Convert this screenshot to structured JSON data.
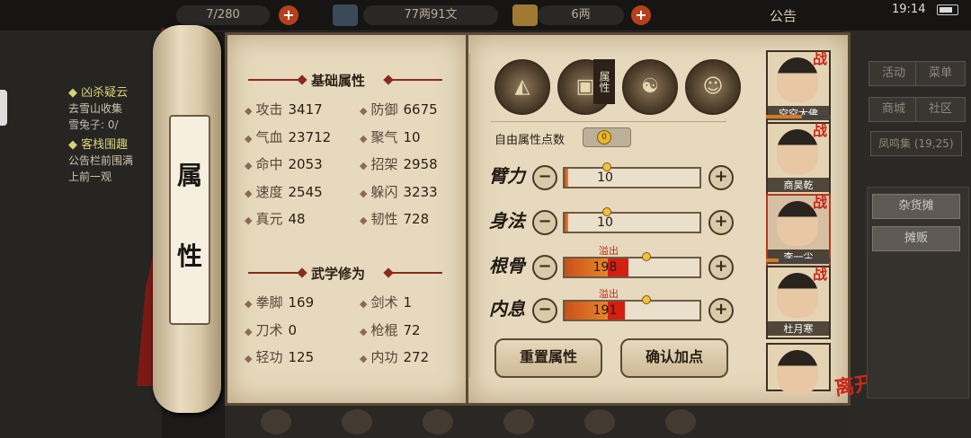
{
  "topbar": {
    "bag_count": "7/280",
    "money": "77两91文",
    "gold": "6两",
    "notice": "公告",
    "time": "19:14"
  },
  "quests": [
    {
      "kind": "title",
      "text": "◆ 凶杀疑云"
    },
    {
      "kind": "text",
      "text": "去雪山收集"
    },
    {
      "kind": "dim",
      "text": "雪兔子: 0/"
    },
    {
      "kind": "title",
      "text": "◆ 客栈围趣"
    },
    {
      "kind": "text",
      "text": "公告栏前围满"
    },
    {
      "kind": "text",
      "text": "上前一观"
    }
  ],
  "scroll_label": [
    "属",
    "性"
  ],
  "basic": {
    "title": "基础属性",
    "stats": [
      {
        "label": "攻击",
        "value": "3417"
      },
      {
        "label": "防御",
        "value": "6675"
      },
      {
        "label": "气血",
        "value": "23712"
      },
      {
        "label": "聚气",
        "value": "10"
      },
      {
        "label": "命中",
        "value": "2053"
      },
      {
        "label": "招架",
        "value": "2958"
      },
      {
        "label": "速度",
        "value": "2545"
      },
      {
        "label": "躲闪",
        "value": "3233"
      },
      {
        "label": "真元",
        "value": "48"
      },
      {
        "label": "韧性",
        "value": "728"
      }
    ]
  },
  "martial": {
    "title": "武学修为",
    "stats": [
      {
        "label": "拳脚",
        "value": "169"
      },
      {
        "label": "剑术",
        "value": "1"
      },
      {
        "label": "刀术",
        "value": "0"
      },
      {
        "label": "枪棍",
        "value": "72"
      },
      {
        "label": "轻功",
        "value": "125"
      },
      {
        "label": "内功",
        "value": "272"
      }
    ]
  },
  "equipment": {
    "tab_label": "属性",
    "icons": [
      "hat-icon",
      "armor-icon",
      "yinyang-icon",
      "figure-icon"
    ]
  },
  "points": {
    "free_label": "自由属性点数",
    "free_value": "0",
    "overflow_label": "溢出",
    "rows": [
      {
        "label": "臂力",
        "value": "10",
        "fill": 0.03,
        "over": 0,
        "overflow": false
      },
      {
        "label": "身法",
        "value": "10",
        "fill": 0.03,
        "over": 0,
        "overflow": false
      },
      {
        "label": "根骨",
        "value": "198",
        "fill": 0.33,
        "over": 0.16,
        "overflow": true
      },
      {
        "label": "内息",
        "value": "191",
        "fill": 0.33,
        "over": 0.13,
        "overflow": true
      }
    ],
    "minus": "−",
    "plus": "+"
  },
  "buttons": {
    "reset": "重置属性",
    "confirm": "确认加点"
  },
  "heroes": [
    {
      "name": "空空大佛",
      "badge": "战",
      "hp": 0.55
    },
    {
      "name": "商昊乾",
      "badge": "战",
      "hp": 0
    },
    {
      "name": "李一尘",
      "badge": "战",
      "hp": 0.2
    },
    {
      "name": "杜月寒",
      "badge": "战",
      "hp": 0
    },
    {
      "name": "",
      "badge": "",
      "hp": 0
    }
  ],
  "leave_label": "离开",
  "right_menu": {
    "row1": [
      "活动",
      "菜单"
    ],
    "row2": [
      "商城",
      "社区"
    ],
    "location": "凤鸣集 (19,25)",
    "stall": "杂货摊",
    "vendor": "摊贩"
  }
}
